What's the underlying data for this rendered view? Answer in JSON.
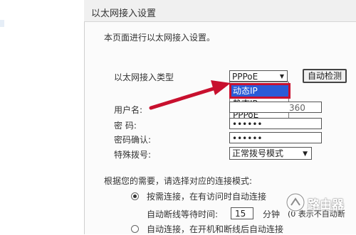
{
  "page": {
    "title": "以太网接入设置",
    "intro": "本页面进行以太网接入设置。"
  },
  "wan": {
    "type_label": "以太网接入类型",
    "type_value": "PPPoE",
    "detect_button": "自动检测",
    "dropdown_options": [
      "动态IP",
      "静态IP",
      "PPPoE"
    ],
    "dropdown_highlighted": "动态IP"
  },
  "form": {
    "username_label": "用户名:",
    "username_tail": "360",
    "password_label": "密  码:",
    "password_value": "••••••",
    "confirm_label": "密码确认:",
    "confirm_value": "••••••",
    "dial_label": "特殊拨号:",
    "dial_value": "正常拨号模式"
  },
  "connection": {
    "prompt": "根据您的需要，请选择对应的连接模式:",
    "on_demand": "按需连接，在有访问时自动连接",
    "idle_label": "自动断线等待时间:",
    "idle_value": "15",
    "idle_unit": "分钟",
    "idle_note": "(0 表示不自动断",
    "auto_connect": "自动连接，在开机和断线后自动连接"
  },
  "watermark": {
    "text": "路由器"
  },
  "colors": {
    "highlight": "#2a5bd7",
    "highlight_outline": "#c8102e",
    "arrow": "#c8102e"
  }
}
